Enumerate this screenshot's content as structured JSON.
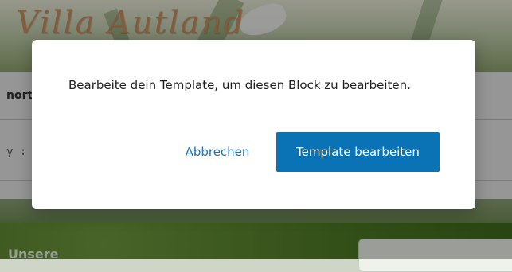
{
  "background": {
    "site_title": "Villa Autland",
    "row_text": "nort",
    "code_text": "y :",
    "footer_text": "Unsere"
  },
  "dialog": {
    "message": "Bearbeite dein Template, um diesen Block zu bearbeiten.",
    "cancel_label": "Abbrechen",
    "primary_label": "Template bearbeiten"
  },
  "colors": {
    "primary_button": "#0a73b5",
    "link": "#2271b1"
  }
}
